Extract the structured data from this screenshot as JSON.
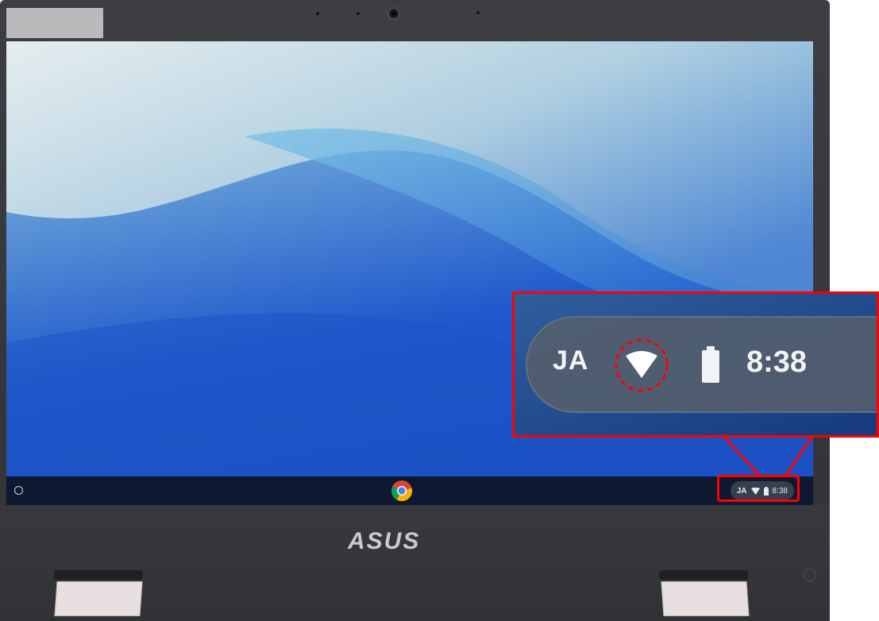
{
  "brand": {
    "logo_text": "ASUS"
  },
  "shelf": {
    "launcher": "launcher-circle-icon",
    "pinned_apps": [
      {
        "name": "chrome-icon"
      }
    ]
  },
  "status_tray": {
    "language": "JA",
    "wifi_icon": "wifi-icon",
    "battery_icon": "battery-icon",
    "time": "8:38"
  },
  "zoom_callout": {
    "language": "JA",
    "time": "8:38",
    "highlighted_icon": "wifi-icon"
  },
  "colors": {
    "highlight": "#ff0000",
    "shelf": "#0e1424",
    "wallpaper_blue": "#1d56c9",
    "bezel": "#3c3e42"
  }
}
